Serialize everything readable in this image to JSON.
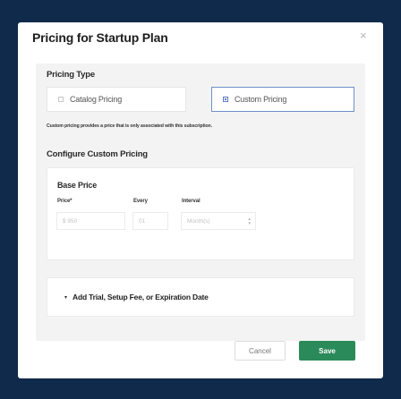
{
  "modal": {
    "title": "Pricing for Startup Plan",
    "close_icon": "×"
  },
  "pricing_type": {
    "label": "Pricing Type",
    "options": [
      {
        "label": "Catalog Pricing",
        "selected": false
      },
      {
        "label": "Custom Pricing",
        "selected": true
      }
    ],
    "note": "Custom pricing provides a price that is only associated with this subscription."
  },
  "configure": {
    "label": "Configure Custom Pricing",
    "base_price": {
      "heading": "Base Price",
      "price_label": "Price*",
      "price_placeholder": "$ 950",
      "every_label": "Every",
      "every_placeholder": "01",
      "interval_label": "Interval",
      "interval_placeholder": "Month(s)"
    }
  },
  "extras": {
    "label": "Add Trial, Setup Fee, or Expiration Date",
    "caret": "▾"
  },
  "footer": {
    "cancel_label": "Cancel",
    "save_label": "Save"
  },
  "colors": {
    "backdrop": "#0f2a4a",
    "accent": "#2b8a5a",
    "selected_border": "#6f8fc9"
  }
}
